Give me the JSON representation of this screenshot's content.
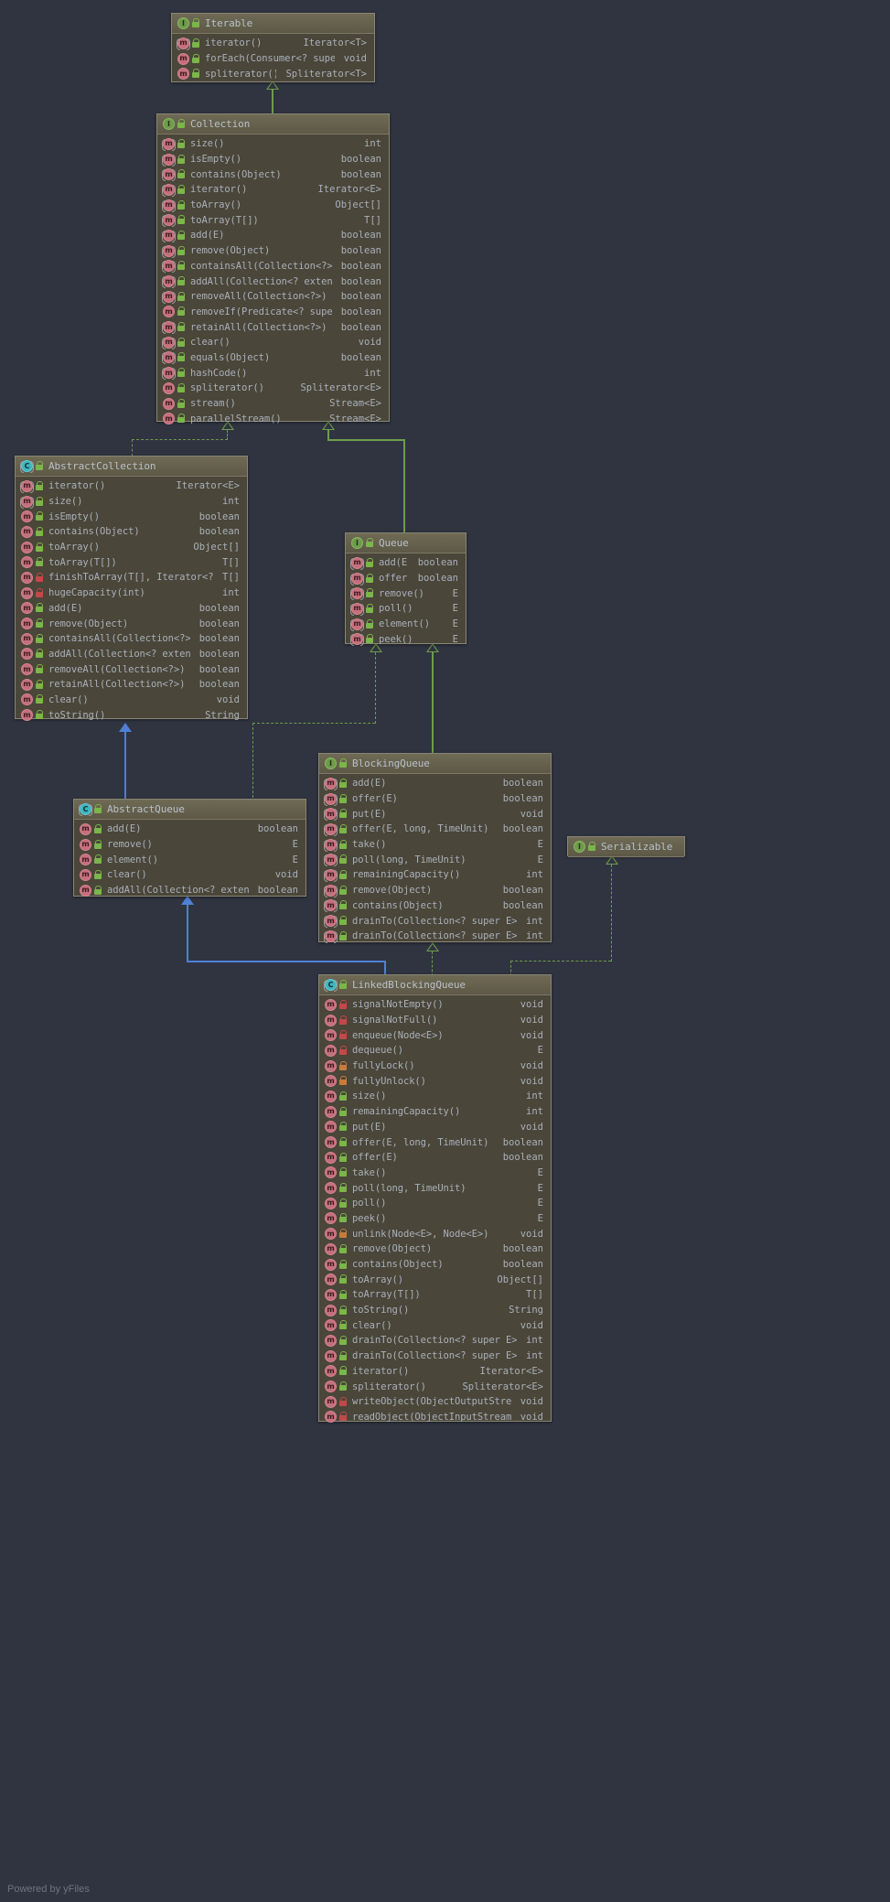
{
  "watermark": "Powered by yFiles",
  "colors": {
    "background": "#2f3440",
    "box_body": "#4a4639",
    "box_header": "#6f6a54",
    "box_border": "#8a8574",
    "text": "#a9b0bb",
    "interface_icon": "#6f9c4b",
    "class_icon": "#3fb5bd",
    "method_icon": "#c4707c",
    "public_lock": "#7ab648",
    "protected_lock": "#c97b3c",
    "private_lock": "#c4474a",
    "inheritance_edge": "#6f9c4b",
    "class_edge": "#4f7fd6"
  },
  "classes": [
    {
      "id": "iterable",
      "name": "Iterable",
      "kind": "interface",
      "kind_icon": "interface-icon",
      "members": [
        {
          "sig": "iterator()",
          "ret": "Iterator<T>",
          "icon": "method-icon",
          "abstract": true,
          "vis": "public"
        },
        {
          "sig": "forEach(Consumer<? super T>)",
          "ret": "void",
          "icon": "method-icon",
          "abstract": false,
          "vis": "public"
        },
        {
          "sig": "spliterator()",
          "ret": "Spliterator<T>",
          "icon": "method-icon",
          "abstract": false,
          "vis": "public"
        }
      ]
    },
    {
      "id": "collection",
      "name": "Collection",
      "kind": "interface",
      "kind_icon": "interface-icon",
      "members": [
        {
          "sig": "size()",
          "ret": "int",
          "icon": "method-icon",
          "abstract": true,
          "vis": "public"
        },
        {
          "sig": "isEmpty()",
          "ret": "boolean",
          "icon": "method-icon",
          "abstract": true,
          "vis": "public"
        },
        {
          "sig": "contains(Object)",
          "ret": "boolean",
          "icon": "method-icon",
          "abstract": true,
          "vis": "public"
        },
        {
          "sig": "iterator()",
          "ret": "Iterator<E>",
          "icon": "method-icon",
          "abstract": true,
          "vis": "public"
        },
        {
          "sig": "toArray()",
          "ret": "Object[]",
          "icon": "method-icon",
          "abstract": true,
          "vis": "public"
        },
        {
          "sig": "toArray(T[])",
          "ret": "T[]",
          "icon": "method-icon",
          "abstract": true,
          "vis": "public"
        },
        {
          "sig": "add(E)",
          "ret": "boolean",
          "icon": "method-icon",
          "abstract": true,
          "vis": "public"
        },
        {
          "sig": "remove(Object)",
          "ret": "boolean",
          "icon": "method-icon",
          "abstract": true,
          "vis": "public"
        },
        {
          "sig": "containsAll(Collection<?>)",
          "ret": "boolean",
          "icon": "method-icon",
          "abstract": true,
          "vis": "public"
        },
        {
          "sig": "addAll(Collection<? extends E>)",
          "ret": "boolean",
          "icon": "method-icon",
          "abstract": true,
          "vis": "public"
        },
        {
          "sig": "removeAll(Collection<?>)",
          "ret": "boolean",
          "icon": "method-icon",
          "abstract": true,
          "vis": "public"
        },
        {
          "sig": "removeIf(Predicate<? super E>)",
          "ret": "boolean",
          "icon": "method-icon",
          "abstract": false,
          "vis": "public"
        },
        {
          "sig": "retainAll(Collection<?>)",
          "ret": "boolean",
          "icon": "method-icon",
          "abstract": true,
          "vis": "public"
        },
        {
          "sig": "clear()",
          "ret": "void",
          "icon": "method-icon",
          "abstract": true,
          "vis": "public"
        },
        {
          "sig": "equals(Object)",
          "ret": "boolean",
          "icon": "method-icon",
          "abstract": true,
          "vis": "public"
        },
        {
          "sig": "hashCode()",
          "ret": "int",
          "icon": "method-icon",
          "abstract": true,
          "vis": "public"
        },
        {
          "sig": "spliterator()",
          "ret": "Spliterator<E>",
          "icon": "method-icon",
          "abstract": false,
          "vis": "public"
        },
        {
          "sig": "stream()",
          "ret": "Stream<E>",
          "icon": "method-icon",
          "abstract": false,
          "vis": "public"
        },
        {
          "sig": "parallelStream()",
          "ret": "Stream<E>",
          "icon": "method-icon",
          "abstract": false,
          "vis": "public"
        }
      ]
    },
    {
      "id": "abstractcollection",
      "name": "AbstractCollection",
      "kind": "class",
      "kind_icon": "class-icon",
      "members": [
        {
          "sig": "iterator()",
          "ret": "Iterator<E>",
          "icon": "method-icon",
          "abstract": true,
          "vis": "public"
        },
        {
          "sig": "size()",
          "ret": "int",
          "icon": "method-icon",
          "abstract": true,
          "vis": "public"
        },
        {
          "sig": "isEmpty()",
          "ret": "boolean",
          "icon": "method-icon",
          "abstract": false,
          "vis": "public"
        },
        {
          "sig": "contains(Object)",
          "ret": "boolean",
          "icon": "method-icon",
          "abstract": false,
          "vis": "public"
        },
        {
          "sig": "toArray()",
          "ret": "Object[]",
          "icon": "method-icon",
          "abstract": false,
          "vis": "public"
        },
        {
          "sig": "toArray(T[])",
          "ret": "T[]",
          "icon": "method-icon",
          "abstract": false,
          "vis": "public"
        },
        {
          "sig": "finishToArray(T[], Iterator<?>)",
          "ret": "T[]",
          "icon": "method-icon",
          "abstract": false,
          "vis": "private"
        },
        {
          "sig": "hugeCapacity(int)",
          "ret": "int",
          "icon": "method-icon",
          "abstract": false,
          "vis": "private"
        },
        {
          "sig": "add(E)",
          "ret": "boolean",
          "icon": "method-icon",
          "abstract": false,
          "vis": "public"
        },
        {
          "sig": "remove(Object)",
          "ret": "boolean",
          "icon": "method-icon",
          "abstract": false,
          "vis": "public"
        },
        {
          "sig": "containsAll(Collection<?>)",
          "ret": "boolean",
          "icon": "method-icon",
          "abstract": false,
          "vis": "public"
        },
        {
          "sig": "addAll(Collection<? extends E>)",
          "ret": "boolean",
          "icon": "method-icon",
          "abstract": false,
          "vis": "public"
        },
        {
          "sig": "removeAll(Collection<?>)",
          "ret": "boolean",
          "icon": "method-icon",
          "abstract": false,
          "vis": "public"
        },
        {
          "sig": "retainAll(Collection<?>)",
          "ret": "boolean",
          "icon": "method-icon",
          "abstract": false,
          "vis": "public"
        },
        {
          "sig": "clear()",
          "ret": "void",
          "icon": "method-icon",
          "abstract": false,
          "vis": "public"
        },
        {
          "sig": "toString()",
          "ret": "String",
          "icon": "method-icon",
          "abstract": false,
          "vis": "public"
        }
      ]
    },
    {
      "id": "queue",
      "name": "Queue",
      "kind": "interface",
      "kind_icon": "interface-icon",
      "members": [
        {
          "sig": "add(E)",
          "ret": "boolean",
          "icon": "method-icon",
          "abstract": true,
          "vis": "public"
        },
        {
          "sig": "offer(E)",
          "ret": "boolean",
          "icon": "method-icon",
          "abstract": true,
          "vis": "public"
        },
        {
          "sig": "remove()",
          "ret": "E",
          "icon": "method-icon",
          "abstract": true,
          "vis": "public"
        },
        {
          "sig": "poll()",
          "ret": "E",
          "icon": "method-icon",
          "abstract": true,
          "vis": "public"
        },
        {
          "sig": "element()",
          "ret": "E",
          "icon": "method-icon",
          "abstract": true,
          "vis": "public"
        },
        {
          "sig": "peek()",
          "ret": "E",
          "icon": "method-icon",
          "abstract": true,
          "vis": "public"
        }
      ]
    },
    {
      "id": "abstractqueue",
      "name": "AbstractQueue",
      "kind": "class",
      "kind_icon": "class-icon",
      "members": [
        {
          "sig": "add(E)",
          "ret": "boolean",
          "icon": "method-icon",
          "abstract": false,
          "vis": "public"
        },
        {
          "sig": "remove()",
          "ret": "E",
          "icon": "method-icon",
          "abstract": false,
          "vis": "public"
        },
        {
          "sig": "element()",
          "ret": "E",
          "icon": "method-icon",
          "abstract": false,
          "vis": "public"
        },
        {
          "sig": "clear()",
          "ret": "void",
          "icon": "method-icon",
          "abstract": false,
          "vis": "public"
        },
        {
          "sig": "addAll(Collection<? extends E>)",
          "ret": "boolean",
          "icon": "method-icon",
          "abstract": false,
          "vis": "public"
        }
      ]
    },
    {
      "id": "blockingqueue",
      "name": "BlockingQueue",
      "kind": "interface",
      "kind_icon": "interface-icon",
      "members": [
        {
          "sig": "add(E)",
          "ret": "boolean",
          "icon": "method-icon",
          "abstract": true,
          "vis": "public"
        },
        {
          "sig": "offer(E)",
          "ret": "boolean",
          "icon": "method-icon",
          "abstract": true,
          "vis": "public"
        },
        {
          "sig": "put(E)",
          "ret": "void",
          "icon": "method-icon",
          "abstract": true,
          "vis": "public"
        },
        {
          "sig": "offer(E, long, TimeUnit)",
          "ret": "boolean",
          "icon": "method-icon",
          "abstract": true,
          "vis": "public"
        },
        {
          "sig": "take()",
          "ret": "E",
          "icon": "method-icon",
          "abstract": true,
          "vis": "public"
        },
        {
          "sig": "poll(long, TimeUnit)",
          "ret": "E",
          "icon": "method-icon",
          "abstract": true,
          "vis": "public"
        },
        {
          "sig": "remainingCapacity()",
          "ret": "int",
          "icon": "method-icon",
          "abstract": true,
          "vis": "public"
        },
        {
          "sig": "remove(Object)",
          "ret": "boolean",
          "icon": "method-icon",
          "abstract": true,
          "vis": "public"
        },
        {
          "sig": "contains(Object)",
          "ret": "boolean",
          "icon": "method-icon",
          "abstract": true,
          "vis": "public"
        },
        {
          "sig": "drainTo(Collection<? super E>)",
          "ret": "int",
          "icon": "method-icon",
          "abstract": true,
          "vis": "public"
        },
        {
          "sig": "drainTo(Collection<? super E>, int)",
          "ret": "int",
          "icon": "method-icon",
          "abstract": true,
          "vis": "public"
        }
      ]
    },
    {
      "id": "serializable",
      "name": "Serializable",
      "kind": "interface",
      "kind_icon": "interface-icon",
      "members": []
    },
    {
      "id": "linkedblockingqueue",
      "name": "LinkedBlockingQueue",
      "kind": "class",
      "kind_icon": "class-icon",
      "members": [
        {
          "sig": "signalNotEmpty()",
          "ret": "void",
          "icon": "method-icon",
          "abstract": false,
          "vis": "private"
        },
        {
          "sig": "signalNotFull()",
          "ret": "void",
          "icon": "method-icon",
          "abstract": false,
          "vis": "private"
        },
        {
          "sig": "enqueue(Node<E>)",
          "ret": "void",
          "icon": "method-icon",
          "abstract": false,
          "vis": "private"
        },
        {
          "sig": "dequeue()",
          "ret": "E",
          "icon": "method-icon",
          "abstract": false,
          "vis": "private"
        },
        {
          "sig": "fullyLock()",
          "ret": "void",
          "icon": "method-icon",
          "abstract": false,
          "vis": "protected"
        },
        {
          "sig": "fullyUnlock()",
          "ret": "void",
          "icon": "method-icon",
          "abstract": false,
          "vis": "protected"
        },
        {
          "sig": "size()",
          "ret": "int",
          "icon": "method-icon",
          "abstract": false,
          "vis": "public"
        },
        {
          "sig": "remainingCapacity()",
          "ret": "int",
          "icon": "method-icon",
          "abstract": false,
          "vis": "public"
        },
        {
          "sig": "put(E)",
          "ret": "void",
          "icon": "method-icon",
          "abstract": false,
          "vis": "public"
        },
        {
          "sig": "offer(E, long, TimeUnit)",
          "ret": "boolean",
          "icon": "method-icon",
          "abstract": false,
          "vis": "public"
        },
        {
          "sig": "offer(E)",
          "ret": "boolean",
          "icon": "method-icon",
          "abstract": false,
          "vis": "public"
        },
        {
          "sig": "take()",
          "ret": "E",
          "icon": "method-icon",
          "abstract": false,
          "vis": "public"
        },
        {
          "sig": "poll(long, TimeUnit)",
          "ret": "E",
          "icon": "method-icon",
          "abstract": false,
          "vis": "public"
        },
        {
          "sig": "poll()",
          "ret": "E",
          "icon": "method-icon",
          "abstract": false,
          "vis": "public"
        },
        {
          "sig": "peek()",
          "ret": "E",
          "icon": "method-icon",
          "abstract": false,
          "vis": "public"
        },
        {
          "sig": "unlink(Node<E>, Node<E>)",
          "ret": "void",
          "icon": "method-icon",
          "abstract": false,
          "vis": "protected"
        },
        {
          "sig": "remove(Object)",
          "ret": "boolean",
          "icon": "method-icon",
          "abstract": false,
          "vis": "public"
        },
        {
          "sig": "contains(Object)",
          "ret": "boolean",
          "icon": "method-icon",
          "abstract": false,
          "vis": "public"
        },
        {
          "sig": "toArray()",
          "ret": "Object[]",
          "icon": "method-icon",
          "abstract": false,
          "vis": "public"
        },
        {
          "sig": "toArray(T[])",
          "ret": "T[]",
          "icon": "method-icon",
          "abstract": false,
          "vis": "public"
        },
        {
          "sig": "toString()",
          "ret": "String",
          "icon": "method-icon",
          "abstract": false,
          "vis": "public"
        },
        {
          "sig": "clear()",
          "ret": "void",
          "icon": "method-icon",
          "abstract": false,
          "vis": "public"
        },
        {
          "sig": "drainTo(Collection<? super E>)",
          "ret": "int",
          "icon": "method-icon",
          "abstract": false,
          "vis": "public"
        },
        {
          "sig": "drainTo(Collection<? super E>, int)",
          "ret": "int",
          "icon": "method-icon",
          "abstract": false,
          "vis": "public"
        },
        {
          "sig": "iterator()",
          "ret": "Iterator<E>",
          "icon": "method-icon",
          "abstract": false,
          "vis": "public"
        },
        {
          "sig": "spliterator()",
          "ret": "Spliterator<E>",
          "icon": "method-icon",
          "abstract": false,
          "vis": "public"
        },
        {
          "sig": "writeObject(ObjectOutputStream)",
          "ret": "void",
          "icon": "method-icon",
          "abstract": false,
          "vis": "private"
        },
        {
          "sig": "readObject(ObjectInputStream)",
          "ret": "void",
          "icon": "method-icon",
          "abstract": false,
          "vis": "private"
        }
      ]
    }
  ]
}
